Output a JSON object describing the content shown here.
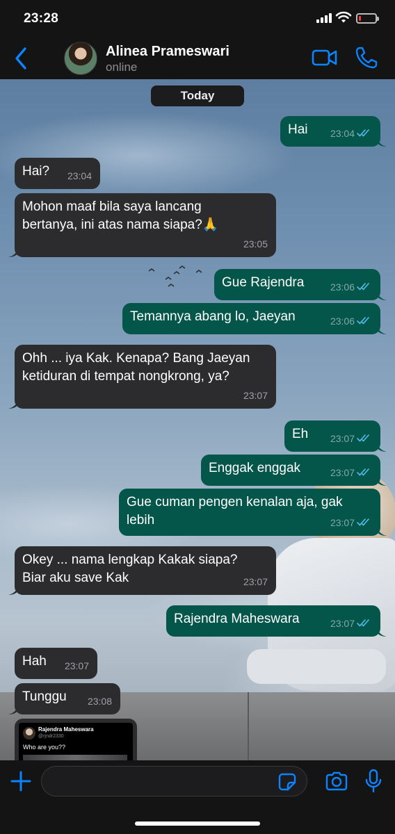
{
  "status_bar": {
    "time": "23:28",
    "battery_level": 0.15
  },
  "header": {
    "contact_name": "Alinea Prameswari",
    "contact_status": "online",
    "icons": [
      "back-chevron-icon",
      "video-call-icon",
      "phone-icon"
    ]
  },
  "chat": {
    "date_label": "Today",
    "messages": [
      {
        "dir": "out",
        "lines": [
          "Hai"
        ],
        "time": "23:04",
        "read": true
      },
      {
        "dir": "in",
        "lines": [
          "Hai?"
        ],
        "time": "23:04"
      },
      {
        "dir": "in",
        "lines": [
          "Mohon maaf bila saya lancang",
          "bertanya, ini atas nama siapa?🙏"
        ],
        "time": "23:05"
      },
      {
        "dir": "out",
        "lines": [
          "Gue Rajendra"
        ],
        "time": "23:06",
        "read": true
      },
      {
        "dir": "out",
        "lines": [
          "Temannya abang lo, Jaeyan"
        ],
        "time": "23:06",
        "read": true
      },
      {
        "dir": "in",
        "lines": [
          "Ohh ... iya Kak. Kenapa? Bang Jaeyan",
          "ketiduran di tempat nongkrong, ya?"
        ],
        "time": "23:07"
      },
      {
        "dir": "out",
        "lines": [
          "Eh"
        ],
        "time": "23:07",
        "read": true
      },
      {
        "dir": "out",
        "lines": [
          "Enggak enggak"
        ],
        "time": "23:07",
        "read": true
      },
      {
        "dir": "out",
        "lines": [
          "Gue cuman pengen kenalan aja, gak",
          "lebih"
        ],
        "time": "23:07",
        "read": true
      },
      {
        "dir": "in",
        "lines": [
          "Okey ... nama lengkap Kakak siapa?",
          "Biar aku save Kak"
        ],
        "time": "23:07"
      },
      {
        "dir": "out",
        "lines": [
          "Rajendra Maheswara"
        ],
        "time": "23:07",
        "read": true
      },
      {
        "dir": "in",
        "lines": [
          "Hah"
        ],
        "time": "23:07"
      },
      {
        "dir": "in",
        "lines": [
          "Tunggu"
        ],
        "time": "23:08"
      }
    ],
    "shared_post": {
      "name": "Rajendra Maheswara",
      "handle": "@rjndr2330",
      "text": "Who are you??"
    }
  },
  "input_bar": {
    "icons": [
      "plus-icon",
      "sticker-icon",
      "camera-icon",
      "microphone-icon"
    ]
  },
  "colors": {
    "accent": "#0a84ff",
    "outgoing_bubble": "#04564a",
    "incoming_bubble": "#2c2c2e",
    "read_tick": "#53bdeb"
  }
}
